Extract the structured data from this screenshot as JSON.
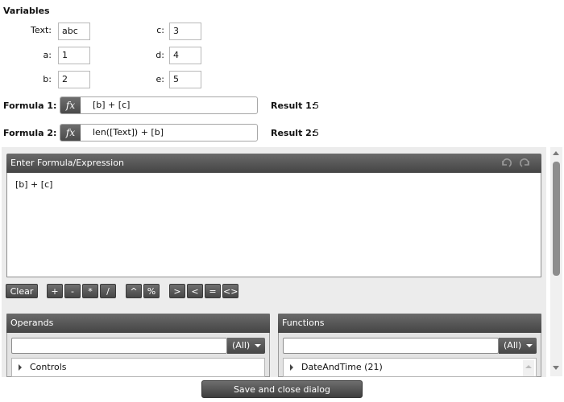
{
  "variables": {
    "title": "Variables",
    "fields": [
      {
        "label": "Text:",
        "value": "abc"
      },
      {
        "label": "a:",
        "value": "1"
      },
      {
        "label": "b:",
        "value": "2"
      },
      {
        "label": "c:",
        "value": "3"
      },
      {
        "label": "d:",
        "value": "4"
      },
      {
        "label": "e:",
        "value": "5"
      }
    ]
  },
  "formulas": [
    {
      "label": "Formula 1:",
      "expression": "[b] + [c]",
      "result_label": "Result 1:",
      "result_value": "5"
    },
    {
      "label": "Formula 2:",
      "expression": "len([Text]) + [b]",
      "result_label": "Result 2:",
      "result_value": "5"
    }
  ],
  "fx_glyph": "fx",
  "editor": {
    "title": "Enter Formula/Expression",
    "content": "[b] + [c]",
    "undo_icon": "undo-icon",
    "redo_icon": "redo-icon"
  },
  "operators": {
    "clear": "Clear",
    "items": [
      "+",
      "-",
      "*",
      "/",
      "^",
      "%",
      ">",
      "<",
      "=",
      "<>"
    ]
  },
  "operands": {
    "title": "Operands",
    "filter": "(All)",
    "items": [
      "Controls"
    ]
  },
  "functions": {
    "title": "Functions",
    "filter": "(All)",
    "items": [
      "DateAndTime (21)"
    ]
  },
  "footer": {
    "save_label": "Save and close dialog"
  }
}
